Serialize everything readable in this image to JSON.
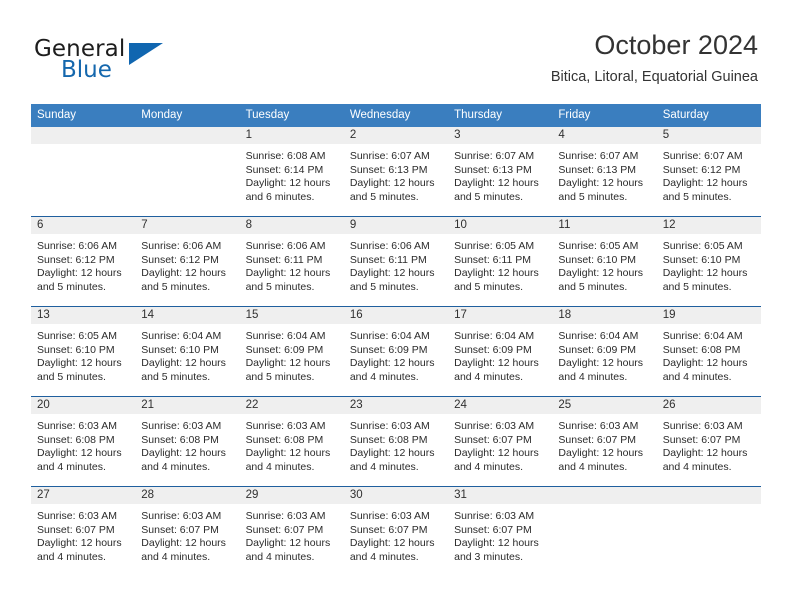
{
  "brand": {
    "name_part1": "General",
    "name_part2": "Blue",
    "logo_icon": "triangle-logo-icon"
  },
  "header": {
    "month_title": "October 2024",
    "location": "Bitica, Litoral, Equatorial Guinea"
  },
  "colors": {
    "header_blue": "#3a7ebf",
    "row_divider_blue": "#1f5f9e",
    "daynum_band": "#efefef",
    "brand_blue": "#1467ad"
  },
  "weekday_headers": [
    "Sunday",
    "Monday",
    "Tuesday",
    "Wednesday",
    "Thursday",
    "Friday",
    "Saturday"
  ],
  "weeks": [
    [
      {
        "day": "",
        "sunrise": "",
        "sunset": "",
        "daylight_line1": "",
        "daylight_line2": ""
      },
      {
        "day": "",
        "sunrise": "",
        "sunset": "",
        "daylight_line1": "",
        "daylight_line2": ""
      },
      {
        "day": "1",
        "sunrise": "Sunrise: 6:08 AM",
        "sunset": "Sunset: 6:14 PM",
        "daylight_line1": "Daylight: 12 hours",
        "daylight_line2": "and 6 minutes."
      },
      {
        "day": "2",
        "sunrise": "Sunrise: 6:07 AM",
        "sunset": "Sunset: 6:13 PM",
        "daylight_line1": "Daylight: 12 hours",
        "daylight_line2": "and 5 minutes."
      },
      {
        "day": "3",
        "sunrise": "Sunrise: 6:07 AM",
        "sunset": "Sunset: 6:13 PM",
        "daylight_line1": "Daylight: 12 hours",
        "daylight_line2": "and 5 minutes."
      },
      {
        "day": "4",
        "sunrise": "Sunrise: 6:07 AM",
        "sunset": "Sunset: 6:13 PM",
        "daylight_line1": "Daylight: 12 hours",
        "daylight_line2": "and 5 minutes."
      },
      {
        "day": "5",
        "sunrise": "Sunrise: 6:07 AM",
        "sunset": "Sunset: 6:12 PM",
        "daylight_line1": "Daylight: 12 hours",
        "daylight_line2": "and 5 minutes."
      }
    ],
    [
      {
        "day": "6",
        "sunrise": "Sunrise: 6:06 AM",
        "sunset": "Sunset: 6:12 PM",
        "daylight_line1": "Daylight: 12 hours",
        "daylight_line2": "and 5 minutes."
      },
      {
        "day": "7",
        "sunrise": "Sunrise: 6:06 AM",
        "sunset": "Sunset: 6:12 PM",
        "daylight_line1": "Daylight: 12 hours",
        "daylight_line2": "and 5 minutes."
      },
      {
        "day": "8",
        "sunrise": "Sunrise: 6:06 AM",
        "sunset": "Sunset: 6:11 PM",
        "daylight_line1": "Daylight: 12 hours",
        "daylight_line2": "and 5 minutes."
      },
      {
        "day": "9",
        "sunrise": "Sunrise: 6:06 AM",
        "sunset": "Sunset: 6:11 PM",
        "daylight_line1": "Daylight: 12 hours",
        "daylight_line2": "and 5 minutes."
      },
      {
        "day": "10",
        "sunrise": "Sunrise: 6:05 AM",
        "sunset": "Sunset: 6:11 PM",
        "daylight_line1": "Daylight: 12 hours",
        "daylight_line2": "and 5 minutes."
      },
      {
        "day": "11",
        "sunrise": "Sunrise: 6:05 AM",
        "sunset": "Sunset: 6:10 PM",
        "daylight_line1": "Daylight: 12 hours",
        "daylight_line2": "and 5 minutes."
      },
      {
        "day": "12",
        "sunrise": "Sunrise: 6:05 AM",
        "sunset": "Sunset: 6:10 PM",
        "daylight_line1": "Daylight: 12 hours",
        "daylight_line2": "and 5 minutes."
      }
    ],
    [
      {
        "day": "13",
        "sunrise": "Sunrise: 6:05 AM",
        "sunset": "Sunset: 6:10 PM",
        "daylight_line1": "Daylight: 12 hours",
        "daylight_line2": "and 5 minutes."
      },
      {
        "day": "14",
        "sunrise": "Sunrise: 6:04 AM",
        "sunset": "Sunset: 6:10 PM",
        "daylight_line1": "Daylight: 12 hours",
        "daylight_line2": "and 5 minutes."
      },
      {
        "day": "15",
        "sunrise": "Sunrise: 6:04 AM",
        "sunset": "Sunset: 6:09 PM",
        "daylight_line1": "Daylight: 12 hours",
        "daylight_line2": "and 5 minutes."
      },
      {
        "day": "16",
        "sunrise": "Sunrise: 6:04 AM",
        "sunset": "Sunset: 6:09 PM",
        "daylight_line1": "Daylight: 12 hours",
        "daylight_line2": "and 4 minutes."
      },
      {
        "day": "17",
        "sunrise": "Sunrise: 6:04 AM",
        "sunset": "Sunset: 6:09 PM",
        "daylight_line1": "Daylight: 12 hours",
        "daylight_line2": "and 4 minutes."
      },
      {
        "day": "18",
        "sunrise": "Sunrise: 6:04 AM",
        "sunset": "Sunset: 6:09 PM",
        "daylight_line1": "Daylight: 12 hours",
        "daylight_line2": "and 4 minutes."
      },
      {
        "day": "19",
        "sunrise": "Sunrise: 6:04 AM",
        "sunset": "Sunset: 6:08 PM",
        "daylight_line1": "Daylight: 12 hours",
        "daylight_line2": "and 4 minutes."
      }
    ],
    [
      {
        "day": "20",
        "sunrise": "Sunrise: 6:03 AM",
        "sunset": "Sunset: 6:08 PM",
        "daylight_line1": "Daylight: 12 hours",
        "daylight_line2": "and 4 minutes."
      },
      {
        "day": "21",
        "sunrise": "Sunrise: 6:03 AM",
        "sunset": "Sunset: 6:08 PM",
        "daylight_line1": "Daylight: 12 hours",
        "daylight_line2": "and 4 minutes."
      },
      {
        "day": "22",
        "sunrise": "Sunrise: 6:03 AM",
        "sunset": "Sunset: 6:08 PM",
        "daylight_line1": "Daylight: 12 hours",
        "daylight_line2": "and 4 minutes."
      },
      {
        "day": "23",
        "sunrise": "Sunrise: 6:03 AM",
        "sunset": "Sunset: 6:08 PM",
        "daylight_line1": "Daylight: 12 hours",
        "daylight_line2": "and 4 minutes."
      },
      {
        "day": "24",
        "sunrise": "Sunrise: 6:03 AM",
        "sunset": "Sunset: 6:07 PM",
        "daylight_line1": "Daylight: 12 hours",
        "daylight_line2": "and 4 minutes."
      },
      {
        "day": "25",
        "sunrise": "Sunrise: 6:03 AM",
        "sunset": "Sunset: 6:07 PM",
        "daylight_line1": "Daylight: 12 hours",
        "daylight_line2": "and 4 minutes."
      },
      {
        "day": "26",
        "sunrise": "Sunrise: 6:03 AM",
        "sunset": "Sunset: 6:07 PM",
        "daylight_line1": "Daylight: 12 hours",
        "daylight_line2": "and 4 minutes."
      }
    ],
    [
      {
        "day": "27",
        "sunrise": "Sunrise: 6:03 AM",
        "sunset": "Sunset: 6:07 PM",
        "daylight_line1": "Daylight: 12 hours",
        "daylight_line2": "and 4 minutes."
      },
      {
        "day": "28",
        "sunrise": "Sunrise: 6:03 AM",
        "sunset": "Sunset: 6:07 PM",
        "daylight_line1": "Daylight: 12 hours",
        "daylight_line2": "and 4 minutes."
      },
      {
        "day": "29",
        "sunrise": "Sunrise: 6:03 AM",
        "sunset": "Sunset: 6:07 PM",
        "daylight_line1": "Daylight: 12 hours",
        "daylight_line2": "and 4 minutes."
      },
      {
        "day": "30",
        "sunrise": "Sunrise: 6:03 AM",
        "sunset": "Sunset: 6:07 PM",
        "daylight_line1": "Daylight: 12 hours",
        "daylight_line2": "and 4 minutes."
      },
      {
        "day": "31",
        "sunrise": "Sunrise: 6:03 AM",
        "sunset": "Sunset: 6:07 PM",
        "daylight_line1": "Daylight: 12 hours",
        "daylight_line2": "and 3 minutes."
      },
      {
        "day": "",
        "sunrise": "",
        "sunset": "",
        "daylight_line1": "",
        "daylight_line2": ""
      },
      {
        "day": "",
        "sunrise": "",
        "sunset": "",
        "daylight_line1": "",
        "daylight_line2": ""
      }
    ]
  ]
}
